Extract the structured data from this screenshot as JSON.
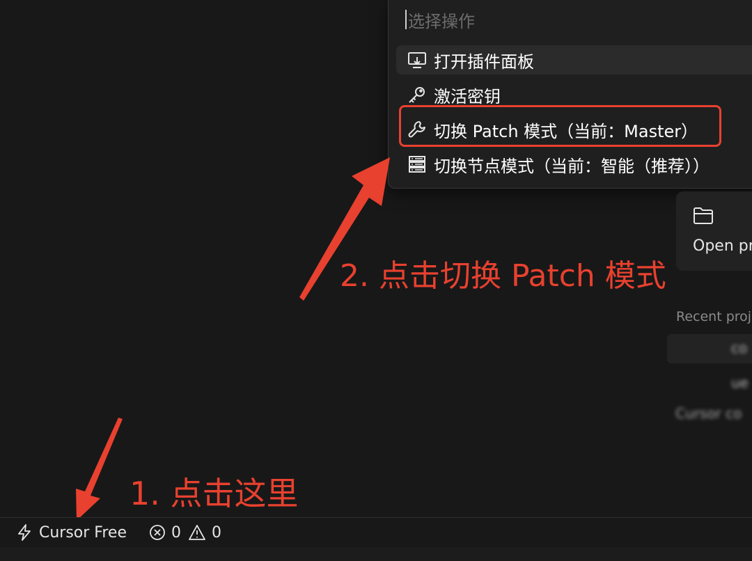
{
  "palette": {
    "placeholder": "选择操作",
    "items": [
      {
        "label": "打开插件面板",
        "icon": "monitor-download-icon",
        "selected": true
      },
      {
        "label": "激活密钥",
        "icon": "key-icon",
        "selected": false
      },
      {
        "label": "切换 Patch 模式（当前：Master）",
        "icon": "wrench-icon",
        "selected": false
      },
      {
        "label": "切换节点模式（当前：智能（推荐））",
        "icon": "server-icon",
        "selected": false
      }
    ]
  },
  "welcome": {
    "open_project_label": "Open pr",
    "recent_title": "Recent proj",
    "recent_items": [
      "co",
      "ue",
      "Cursor co"
    ]
  },
  "annotations": {
    "step1": "1. 点击这里",
    "step2": "2. 点击切换 Patch 模式",
    "color": "#e8412f"
  },
  "statusbar": {
    "plan_label": "Cursor Free",
    "errors": "0",
    "warnings": "0"
  }
}
